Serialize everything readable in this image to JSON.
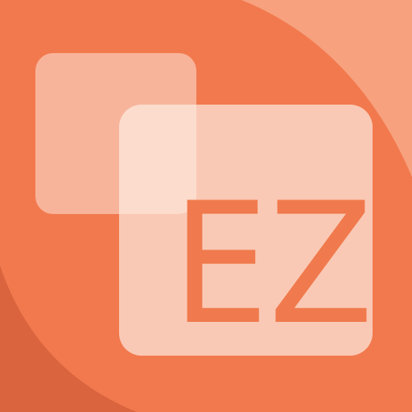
{
  "logo": {
    "text": "EZ",
    "shapes": [
      "back-square",
      "front-square"
    ]
  },
  "colors": {
    "background": "#F2794E",
    "background_light_arc": "#F7A17E",
    "background_dark_corner": "#D9643D",
    "square_back": "#F8B49A",
    "square_front": "#FAC9B5",
    "square_overlap": "#FCDCCD",
    "text": "#F07A4D"
  }
}
